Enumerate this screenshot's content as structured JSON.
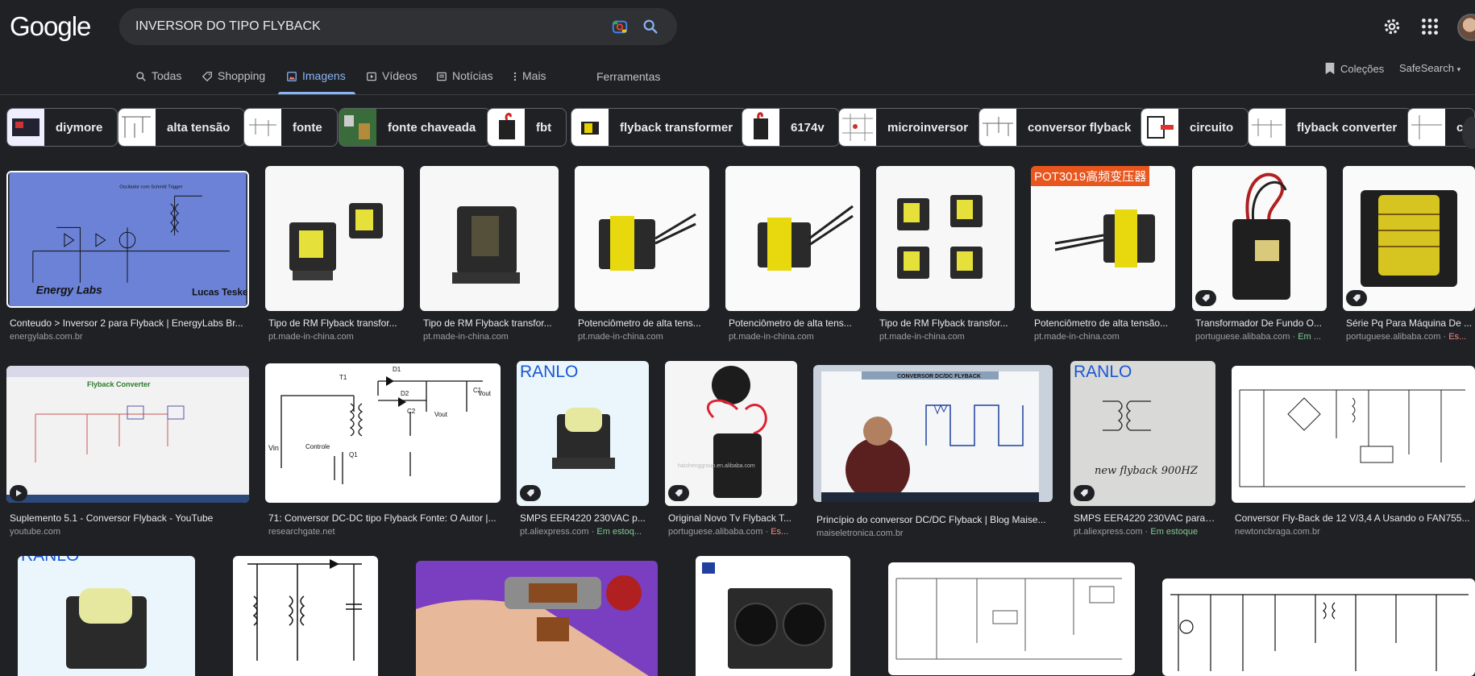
{
  "header": {
    "logo": "Google",
    "query": "INVERSOR DO TIPO FLYBACK"
  },
  "tabs": [
    {
      "label": "Todas",
      "icon": "search-icon"
    },
    {
      "label": "Shopping",
      "icon": "tag-icon"
    },
    {
      "label": "Imagens",
      "icon": "image-icon",
      "active": true
    },
    {
      "label": "Vídeos",
      "icon": "play-icon"
    },
    {
      "label": "Notícias",
      "icon": "news-icon"
    },
    {
      "label": "Mais",
      "icon": "more-vert-icon"
    }
  ],
  "tools_label": "Ferramentas",
  "collections_label": "Coleções",
  "safesearch_label": "SafeSearch",
  "chips": [
    "diymore",
    "alta tensão",
    "fonte",
    "fonte chaveada",
    "fbt",
    "flyback transformer",
    "6174v",
    "microinversor",
    "conversor flyback",
    "circuito",
    "flyback converter",
    "c"
  ],
  "results_row1": [
    {
      "caption": "Conteudo > Inversor 2 para Flyback | EnergyLabs Br...",
      "source": "energylabs.com.br"
    },
    {
      "caption": "Tipo de RM Flyback transfor...",
      "source": "pt.made-in-china.com"
    },
    {
      "caption": "Tipo de RM Flyback transfor...",
      "source": "pt.made-in-china.com"
    },
    {
      "caption": "Potenciômetro de alta tens...",
      "source": "pt.made-in-china.com"
    },
    {
      "caption": "Potenciômetro de alta tens...",
      "source": "pt.made-in-china.com"
    },
    {
      "caption": "Tipo de RM Flyback transfor...",
      "source": "pt.made-in-china.com"
    },
    {
      "caption": "Potenciômetro de alta tensão...",
      "source": "pt.made-in-china.com"
    },
    {
      "caption": "Transformador De Fundo O...",
      "source": "portuguese.alibaba.com",
      "extra": "Em ..."
    },
    {
      "caption": "Série Pq Para Máquina De ...",
      "source": "portuguese.alibaba.com",
      "extra": "Es..."
    }
  ],
  "results_row2": [
    {
      "caption": "Suplemento 5.1 - Conversor Flyback - YouTube",
      "source": "youtube.com"
    },
    {
      "caption": "71: Conversor DC-DC tipo Flyback Fonte: O Autor |...",
      "source": "researchgate.net"
    },
    {
      "caption": "SMPS EER4220 230VAC p...",
      "source": "pt.aliexpress.com",
      "extra": "Em estoq..."
    },
    {
      "caption": "Original Novo Tv Flyback T...",
      "source": "portuguese.alibaba.com",
      "extra": "Es..."
    },
    {
      "caption": "Princípio do conversor DC/DC Flyback | Blog Maise...",
      "source": "maiseletronica.com.br"
    },
    {
      "caption": "SMPS EER4220 230VAC para ...",
      "source": "pt.aliexpress.com",
      "extra": "Em estoque"
    },
    {
      "caption": "Conversor Fly-Back de 12 V/3,4 A Usando o FAN755...",
      "source": "newtoncbraga.com.br"
    }
  ],
  "image_text": {
    "energy_labs": "Energy Labs",
    "lucas_teske": "Lucas Teske",
    "oscillator": "Oscilador com Schmitt Trigger",
    "pot_banner": "POT3019高频变压器",
    "ranlo": "RANLO",
    "flyback_converter": "Flyback Converter",
    "conversor_dcdc": "CONVERSOR DC/DC FLYBACK",
    "hw_note": "new flyback 900HZ",
    "watermark_img": "haishenggroup.en.alibaba.com",
    "schem_vin": "Vin",
    "schem_t1": "T1",
    "schem_d1": "D1",
    "schem_d2": "D2",
    "schem_c1": "C1",
    "schem_c2": "C2",
    "schem_vout1": "Vout",
    "schem_vout2": "Vout",
    "schem_controle": "Controle",
    "schem_q1": "Q1"
  },
  "colors": {
    "bg": "#202124",
    "link": "#8ab4f8",
    "stock_green": "#81c995",
    "red": "#f28b82"
  }
}
